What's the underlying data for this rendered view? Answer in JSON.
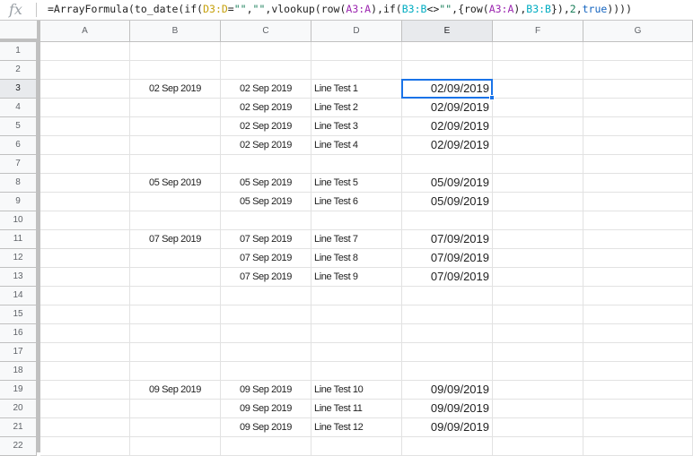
{
  "formula_bar": {
    "fx_icon": "fx",
    "tokens": [
      {
        "t": "=ArrayFormula(to_date(if(",
        "c": "#222222"
      },
      {
        "t": "D3:D",
        "c": "#c6a10d"
      },
      {
        "t": "=",
        "c": "#222222"
      },
      {
        "t": "\"\"",
        "c": "#1a7f5a"
      },
      {
        "t": ",",
        "c": "#222222"
      },
      {
        "t": "\"\"",
        "c": "#1a7f5a"
      },
      {
        "t": ",vlookup(row(",
        "c": "#222222"
      },
      {
        "t": "A3:A",
        "c": "#9c27b0"
      },
      {
        "t": "),if(",
        "c": "#222222"
      },
      {
        "t": "B3:B",
        "c": "#00acc1"
      },
      {
        "t": "<>",
        "c": "#222222"
      },
      {
        "t": "\"\"",
        "c": "#1a7f5a"
      },
      {
        "t": ",{row(",
        "c": "#222222"
      },
      {
        "t": "A3:A",
        "c": "#9c27b0"
      },
      {
        "t": "),",
        "c": "#222222"
      },
      {
        "t": "B3:B",
        "c": "#00acc1"
      },
      {
        "t": "}),",
        "c": "#222222"
      },
      {
        "t": "2",
        "c": "#1a7f5a"
      },
      {
        "t": ",",
        "c": "#222222"
      },
      {
        "t": "true",
        "c": "#1565c0"
      },
      {
        "t": "))))",
        "c": "#222222"
      }
    ]
  },
  "columns": [
    "A",
    "B",
    "C",
    "D",
    "E",
    "F",
    "G"
  ],
  "selected_column": "E",
  "selected_cell": "E3",
  "rows": [
    {
      "n": "1",
      "B": "",
      "C": "",
      "D": "",
      "E": ""
    },
    {
      "n": "2",
      "B": "",
      "C": "",
      "D": "",
      "E": ""
    },
    {
      "n": "3",
      "B": "02 Sep 2019",
      "C": "02 Sep 2019",
      "D": "Line Test 1",
      "E": "02/09/2019"
    },
    {
      "n": "4",
      "B": "",
      "C": "02 Sep 2019",
      "D": "Line Test 2",
      "E": "02/09/2019"
    },
    {
      "n": "5",
      "B": "",
      "C": "02 Sep 2019",
      "D": "Line Test 3",
      "E": "02/09/2019"
    },
    {
      "n": "6",
      "B": "",
      "C": "02 Sep 2019",
      "D": "Line Test 4",
      "E": "02/09/2019"
    },
    {
      "n": "7",
      "B": "",
      "C": "",
      "D": "",
      "E": ""
    },
    {
      "n": "8",
      "B": "05 Sep 2019",
      "C": "05 Sep 2019",
      "D": "Line Test 5",
      "E": "05/09/2019"
    },
    {
      "n": "9",
      "B": "",
      "C": "05 Sep 2019",
      "D": "Line Test 6",
      "E": "05/09/2019"
    },
    {
      "n": "10",
      "B": "",
      "C": "",
      "D": "",
      "E": ""
    },
    {
      "n": "11",
      "B": "07 Sep 2019",
      "C": "07 Sep 2019",
      "D": "Line Test 7",
      "E": "07/09/2019"
    },
    {
      "n": "12",
      "B": "",
      "C": "07 Sep 2019",
      "D": "Line Test 8",
      "E": "07/09/2019"
    },
    {
      "n": "13",
      "B": "",
      "C": "07 Sep 2019",
      "D": "Line Test 9",
      "E": "07/09/2019"
    },
    {
      "n": "14",
      "B": "",
      "C": "",
      "D": "",
      "E": ""
    },
    {
      "n": "15",
      "B": "",
      "C": "",
      "D": "",
      "E": ""
    },
    {
      "n": "16",
      "B": "",
      "C": "",
      "D": "",
      "E": ""
    },
    {
      "n": "17",
      "B": "",
      "C": "",
      "D": "",
      "E": ""
    },
    {
      "n": "18",
      "B": "",
      "C": "",
      "D": "",
      "E": ""
    },
    {
      "n": "19",
      "B": "09 Sep 2019",
      "C": "09 Sep 2019",
      "D": "Line Test 10",
      "E": "09/09/2019"
    },
    {
      "n": "20",
      "B": "",
      "C": "09 Sep 2019",
      "D": "Line Test 11",
      "E": "09/09/2019"
    },
    {
      "n": "21",
      "B": "",
      "C": "09 Sep 2019",
      "D": "Line Test 12",
      "E": "09/09/2019"
    },
    {
      "n": "22",
      "B": "",
      "C": "",
      "D": "",
      "E": ""
    }
  ],
  "colors": {
    "selection": "#1a73e8",
    "header_bg": "#f8f9fa",
    "header_selected_bg": "#e8eaed"
  }
}
